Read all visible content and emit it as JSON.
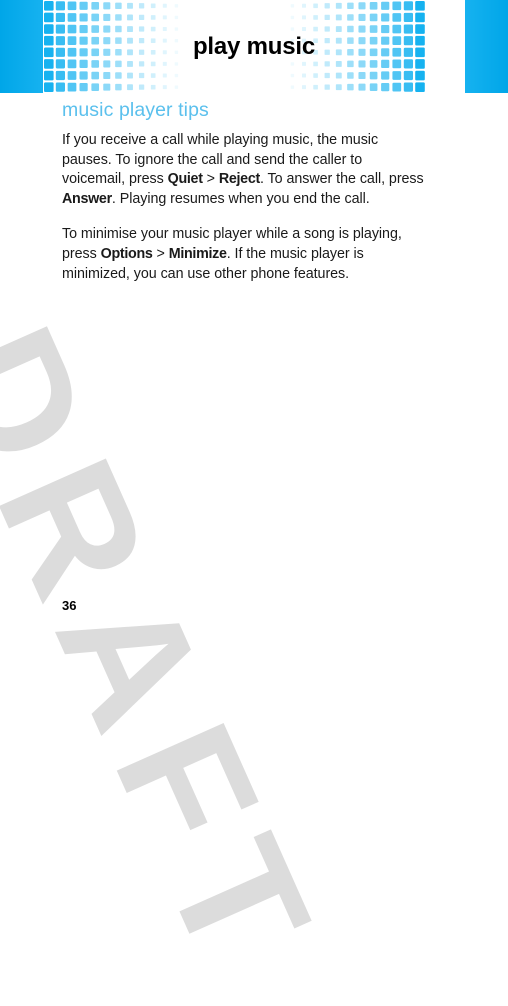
{
  "header": {
    "title": "play music",
    "accent_color": "#00a6e8",
    "accent_light": "#16b2f0",
    "pattern_icon": "checker-grid-pattern"
  },
  "watermark": {
    "text": "DRAFT",
    "color": "#dcdcdc"
  },
  "content": {
    "section_heading": "music player tips",
    "heading_color": "#5bc0ed",
    "paragraphs": [
      {
        "runs": [
          {
            "text": "If you receive a call while playing music, the music pauses. To ignore the call and send the caller to voicemail, press ",
            "bold": false
          },
          {
            "text": "Quiet",
            "bold": true
          },
          {
            "text": " > ",
            "bold": false
          },
          {
            "text": "Reject",
            "bold": true
          },
          {
            "text": ". To answer the call, press ",
            "bold": false
          },
          {
            "text": "Answer",
            "bold": true
          },
          {
            "text": ". Playing resumes when you end the call.",
            "bold": false
          }
        ]
      },
      {
        "runs": [
          {
            "text": "To minimise your music player while a song is playing, press ",
            "bold": false
          },
          {
            "text": "Options",
            "bold": true
          },
          {
            "text": " > ",
            "bold": false
          },
          {
            "text": "Minimize",
            "bold": true
          },
          {
            "text": ". If the music player is minimized, you can use other phone features.",
            "bold": false
          }
        ]
      }
    ]
  },
  "footer": {
    "page_number": "36"
  }
}
